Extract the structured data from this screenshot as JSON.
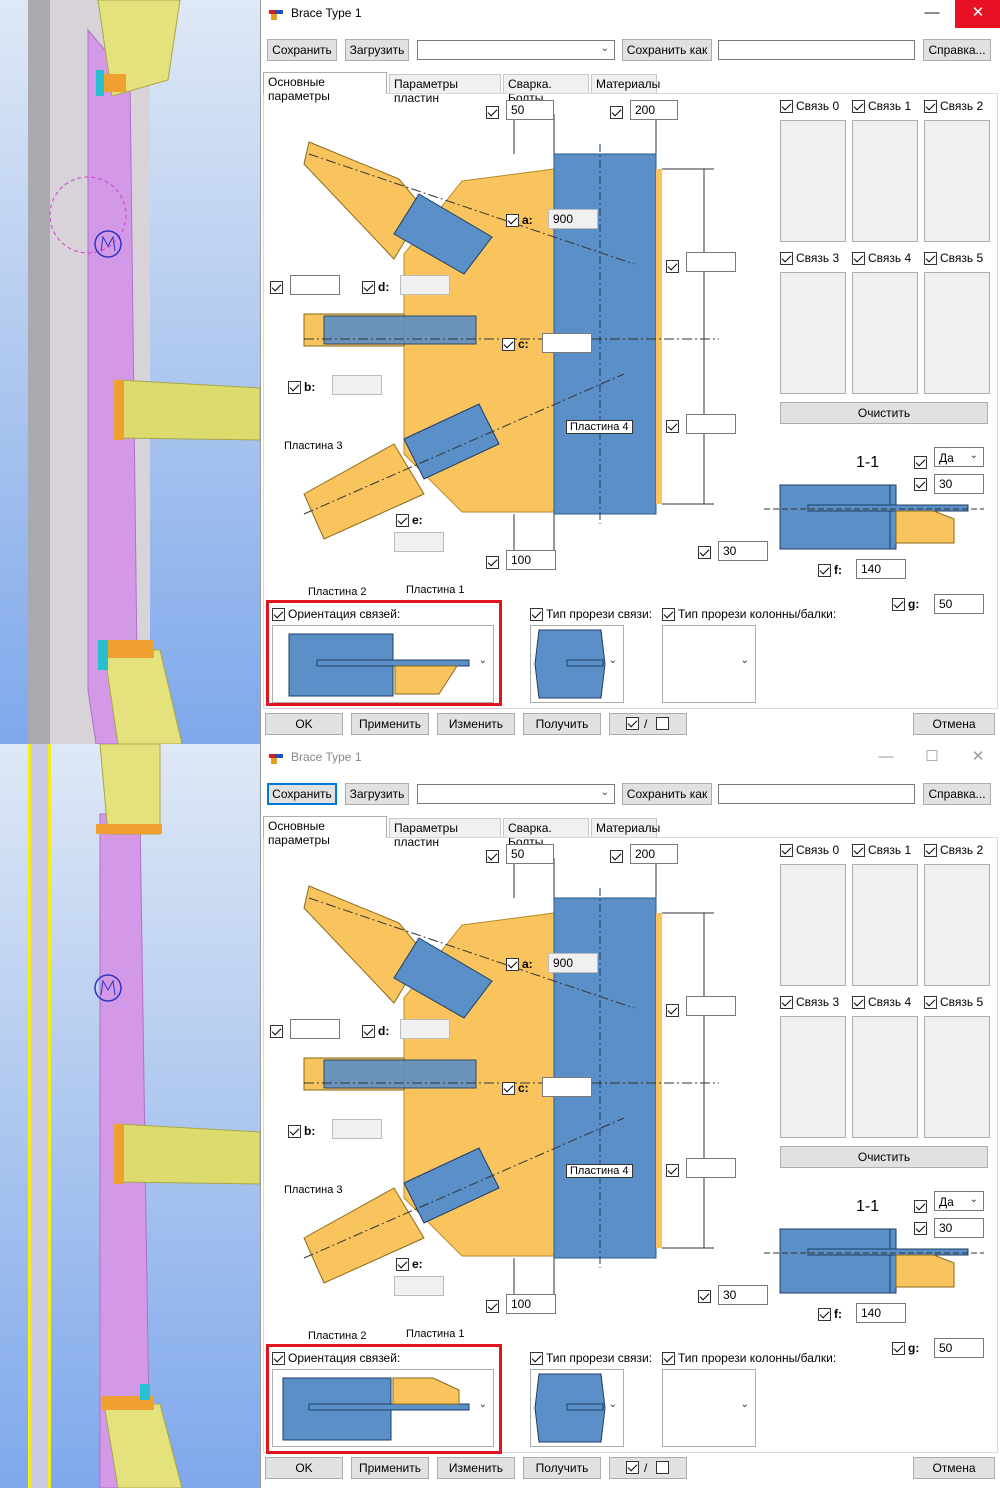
{
  "dialog": {
    "title": "Brace Type 1",
    "window_controls": {
      "minimize": "—",
      "maximize": "☐",
      "close": "✕"
    }
  },
  "toolbar": {
    "save_label": "Сохранить",
    "load_label": "Загрузить",
    "preset_value": "",
    "save_as_label": "Сохранить как",
    "save_as_value": "",
    "help_label": "Справка..."
  },
  "tabs": [
    "Основные параметры",
    "Параметры пластин",
    "Сварка. Болты",
    "Материалы"
  ],
  "params": {
    "top_left": "50",
    "top_right": "200",
    "a_label": "a:",
    "a_value": "900",
    "b_label": "b:",
    "b_value": "",
    "c_label": "c:",
    "c_value": "",
    "d_label": "d:",
    "d_value": "",
    "e_label": "e:",
    "e_value": "",
    "left_upper": "",
    "right_upper": "",
    "right_lower": "",
    "bottom_value": "100",
    "plate1": "Пластина 1",
    "plate2": "Пластина 2",
    "plate3": "Пластина 3",
    "plate4": "Пластина 4"
  },
  "braces": [
    "Связь 0",
    "Связь 1",
    "Связь 2",
    "Связь 3",
    "Связь 4",
    "Связь 5"
  ],
  "clear_label": "Очистить",
  "section": {
    "title": "1-1",
    "yes_value": "Да",
    "top_value": "30",
    "left_value": "30",
    "f_label": "f:",
    "f_value": "140",
    "g_label": "g:",
    "g_value": "50"
  },
  "options": {
    "orientation_label": "Ориентация связей:",
    "brace_cut_label": "Тип прорези связи:",
    "column_cut_label": "Тип прорези колонны/балки:"
  },
  "footer": {
    "ok_label": "OK",
    "apply_label": "Применить",
    "modify_label": "Изменить",
    "get_label": "Получить",
    "toggle_label": "/",
    "cancel_label": "Отмена"
  },
  "colors": {
    "plate_orange": "#f9c45e",
    "steel_blue": "#5b8fc7",
    "highlight_red": "#e0141e",
    "close_red": "#e81123",
    "column_magenta": "#d199e0"
  }
}
